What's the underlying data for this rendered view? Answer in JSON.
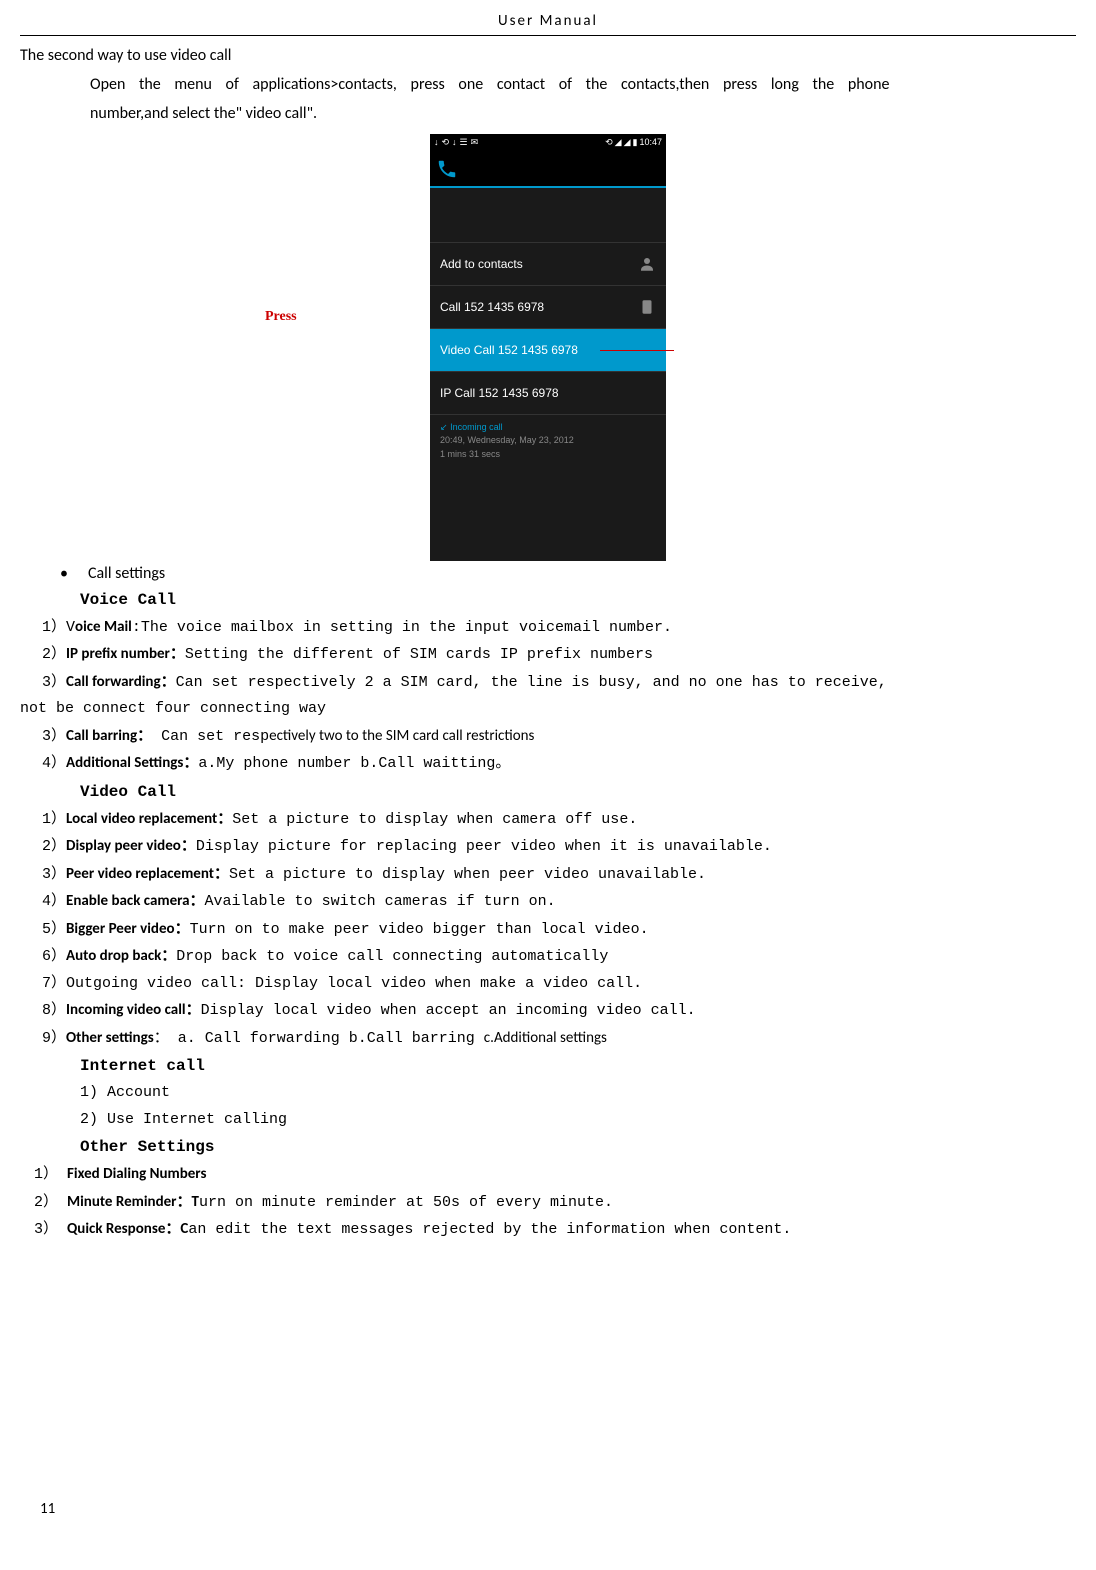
{
  "header": "User    Manual",
  "section_title": "The second way to use video call",
  "body1": "Open  the  menu  of  applications>contacts,  press    one  contact  of  the  contacts,then  press  long  the  phone",
  "body2": "number,and select the\" video call\".",
  "status": {
    "time": "10:47"
  },
  "phone": {
    "add_status": "Add to contacts",
    "call": "Call 152 1435 6978",
    "video_call": "Video Call 152 1435 6978",
    "ip_call": "IP Call 152 1435 6978",
    "incoming_label": "Incoming call",
    "timestamp": "20:49, Wednesday, May 23, 2012",
    "duration": "1 mins 31 secs"
  },
  "press_label": "Press",
  "bullet_label": "Call settings",
  "voice_call_heading": "Voice Call",
  "voice": {
    "l1_num": "1）V",
    "l1_bold": "oice Mail",
    "l1_text": ":The voice mailbox in setting in the input voicemail number.",
    "l2_num": "2）",
    "l2_bold": "IP prefix number：",
    "l2_text": "Setting the different of SIM cards IP prefix numbers",
    "l3_num": "3）",
    "l3_bold": "Call forwarding：",
    "l3_text": "Can set respectively 2 a SIM card, the line is busy, and no one has to receive,",
    "l3_wrap": "not be connect four connecting way",
    "l4_num": "3）",
    "l4_bold": "Call barring：",
    "l4_text": " Can set resp",
    "l4_sans": "ectively two to the SIM card call restrictions",
    "l5_num": "4）",
    "l5_bold": "Additional Settings：",
    "l5_text": "a.My phone number b.Call waitting。"
  },
  "video_call_heading": "Video Call",
  "video": {
    "l1_num": "1）",
    "l1_bold": "Local video replacement：",
    "l1_text": "Set a picture to display when camera off use.",
    "l2_num": "2）",
    "l2_bold": "Display peer video：",
    "l2_text": "Display picture for replacing peer video when it is unavailable.",
    "l3_num": "3）",
    "l3_bold": "Peer video replacement：",
    "l3_text": "Set a picture to display when peer video unavailable.",
    "l4_num": "4）",
    "l4_bold": "Enable back camera：",
    "l4_text": "Available to switch cameras if turn on.",
    "l5_num": "5）",
    "l5_bold": "Bigger Peer video：",
    "l5_text": "Turn on to make peer video bigger than local video.",
    "l6_num": "6）",
    "l6_bold": "Auto drop back：",
    "l6_text": "Drop back to voice call connecting automatically",
    "l7_num": "7）",
    "l7_text": "Outgoing video call: Display local video when make a video call.",
    "l8_num": "8）",
    "l8_bold": "Incoming video call：",
    "l8_text": "Display local video when accept an incoming video call.",
    "l9_num": "9）",
    "l9_bold": "Other settings",
    "l9_text": "：  a. Call forwarding  b.Call barring  ",
    "l9_sans": "c.Additional settings"
  },
  "internet_heading": "Internet call",
  "internet": {
    "l1": "1)  Account",
    "l2": "2)  Use Internet calling"
  },
  "other_heading": "Other Settings",
  "other": {
    "l1_num": "1） ",
    "l1_bold": "Fixed Dialing Numbers",
    "l2_num": "2） ",
    "l2_bold": "Minute Reminder：T",
    "l2_text": "urn on minute reminder at 50s of every minute.",
    "l3_num": "3） ",
    "l3_bold": "Quick Response：C",
    "l3_text": "an edit the text messages rejected by the information when content."
  },
  "page_number": "11"
}
